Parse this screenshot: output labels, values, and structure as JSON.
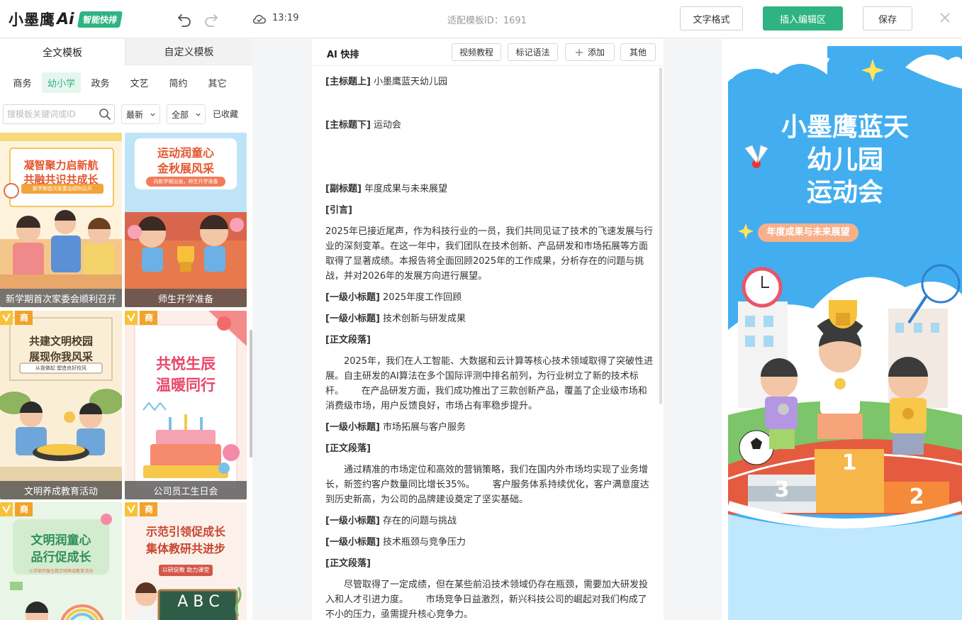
{
  "header": {
    "logo_text": "小墨鹰",
    "logo_ai": "Ai",
    "logo_badge": "智能快排",
    "time": "13:19",
    "template_id": "适配模板ID：1691",
    "btn_format": "文字格式",
    "btn_insert": "插入编辑区",
    "btn_save": "保存"
  },
  "left": {
    "tabs": [
      "全文模板",
      "自定义模板"
    ],
    "categories": [
      "商务",
      "幼小学",
      "政务",
      "文艺",
      "简约",
      "其它"
    ],
    "active_category": "幼小学",
    "search_placeholder": "搜模板关键词或ID",
    "sort_select": "最新",
    "range_select": "全部",
    "favorites": "已收藏",
    "cards": [
      {
        "caption": "新学期首次家委会顺利召开",
        "title1": "凝智聚力启新航",
        "title2": "共融共识共成长",
        "sub": "新学期首次家委会顺利召开"
      },
      {
        "caption": "师生开学准备",
        "title1": "运动润童心",
        "title2": "金秋展风采",
        "sub": "向新学期出发，师生开学准备"
      },
      {
        "caption": "文明养成教育活动",
        "badge": "商",
        "title1": "共建文明校园",
        "title2": "展现你我风采",
        "sub": "从我做起 塑造良好校风"
      },
      {
        "caption": "公司员工生日会",
        "badge": "商",
        "title1": "共悦生辰",
        "title2": "温暖同行"
      },
      {
        "caption": "",
        "badge": "商",
        "title1": "文明润童心",
        "title2": "品行促成长",
        "sub": "小学部开展主题文明养成教育活动"
      },
      {
        "caption": "",
        "badge": "商",
        "title1": "示范引领促成长",
        "title2": "集体教研共进步",
        "sub": "以研促教  助力课堂",
        "board": "A B C"
      }
    ]
  },
  "mid": {
    "title": "AI 快排",
    "btn_video": "视频教程",
    "btn_syntax": "标记语法",
    "btn_add": "添加",
    "btn_other": "其他",
    "lines": [
      {
        "tag": "[主标题上]",
        "text": " 小墨鹰蓝天幼儿园"
      },
      {
        "tag": "[主标题下]",
        "text": " 运动会"
      },
      {
        "tag": "[副标题]",
        "text": " 年度成果与未来展望"
      },
      {
        "tag": "[引言]",
        "text": ""
      },
      {
        "tag": "",
        "text": "2025年已接近尾声，作为科技行业的一员，我们共同见证了技术的飞速发展与行业的深刻变革。在这一年中，我们团队在技术创新、产品研发和市场拓展等方面取得了显著成绩。本报告将全面回顾2025年的工作成果，分析存在的问题与挑战，并对2026年的发展方向进行展望。"
      },
      {
        "tag": "[一级小标题]",
        "text": " 2025年度工作回顾"
      },
      {
        "tag": "[一级小标题]",
        "text": " 技术创新与研发成果"
      },
      {
        "tag": "[正文段落]",
        "text": ""
      },
      {
        "tag": "",
        "text": "2025年，我们在人工智能、大数据和云计算等核心技术领域取得了突破性进展。自主研发的AI算法在多个国际评测中排名前列，为行业树立了新的技术标杆。      在产品研发方面，我们成功推出了三款创新产品，覆盖了企业级市场和消费级市场，用户反馈良好，市场占有率稳步提升。",
        "body": true
      },
      {
        "tag": "[一级小标题]",
        "text": " 市场拓展与客户服务"
      },
      {
        "tag": "[正文段落]",
        "text": ""
      },
      {
        "tag": "",
        "text": "通过精准的市场定位和高效的营销策略，我们在国内外市场均实现了业务增长，新签约客户数量同比增长35%。      客户服务体系持续优化，客户满意度达到历史新高，为公司的品牌建设奠定了坚实基础。",
        "body": true
      },
      {
        "tag": "[一级小标题]",
        "text": " 存在的问题与挑战"
      },
      {
        "tag": "[一级小标题]",
        "text": " 技术瓶颈与竞争压力"
      },
      {
        "tag": "[正文段落]",
        "text": ""
      },
      {
        "tag": "",
        "text": "尽管取得了一定成绩，但在某些前沿技术领域仍存在瓶颈，需要加大研发投入和人才引进力度。      市场竞争日益激烈，新兴科技公司的崛起对我们构成了不小的压力，亟需提升核心竞争力。",
        "body": true
      }
    ]
  },
  "preview": {
    "title1": "小墨鹰蓝天",
    "title2": "幼儿园",
    "title3": "运动会",
    "subtitle": "年度成果与未来展望",
    "podium": [
      "1",
      "2",
      "3"
    ]
  },
  "colors": {
    "accent": "#2fb383",
    "sky": "#42aef0",
    "pill": "#f7b08a"
  }
}
